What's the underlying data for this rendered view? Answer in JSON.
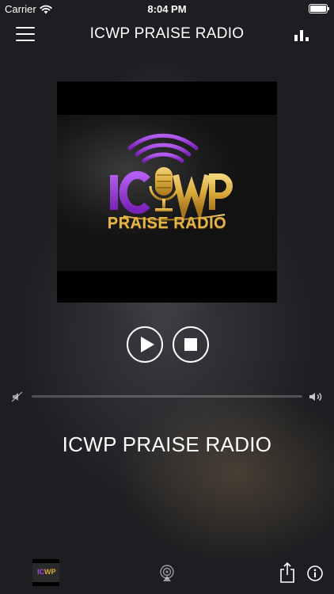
{
  "status_bar": {
    "carrier": "Carrier",
    "time": "8:04 PM",
    "icons": [
      "wifi-icon",
      "battery-icon"
    ]
  },
  "nav": {
    "title": "ICWP PRAISE RADIO",
    "left_icon": "hamburger-menu-icon",
    "right_icon": "equalizer-icon"
  },
  "artwork": {
    "logo_text_top": "IC WP",
    "logo_text_bottom": "PRAISE RADIO",
    "colors": {
      "purple": "#8b2fc9",
      "gold": "#d9a93a"
    }
  },
  "controls": {
    "play_icon": "play-icon",
    "stop_icon": "stop-icon"
  },
  "volume": {
    "level": 0.0,
    "low_icon": "volume-mute-icon",
    "high_icon": "volume-high-icon"
  },
  "station": {
    "name": "ICWP PRAISE RADIO"
  },
  "bottom_bar": {
    "icons": [
      "station-thumbnail",
      "airplay-icon",
      "share-icon",
      "info-icon"
    ]
  }
}
